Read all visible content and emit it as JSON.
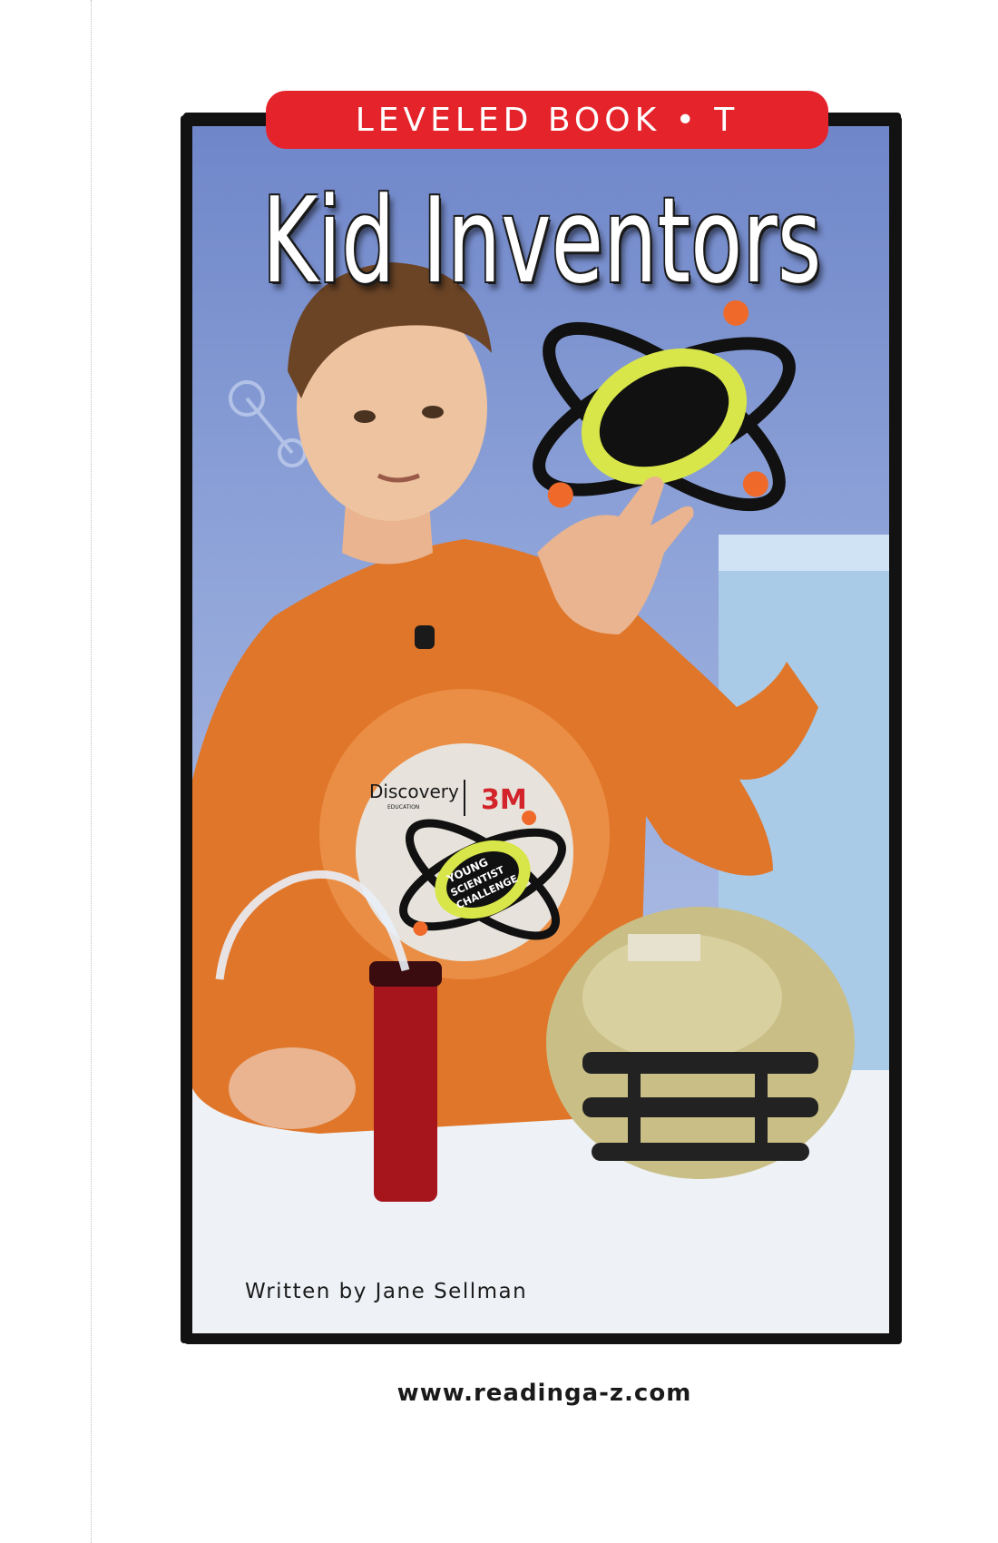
{
  "banner": {
    "label": "LEVELED BOOK • T"
  },
  "cover": {
    "title": "Kid Inventors",
    "author_line": "Written by Jane Sellman",
    "photo": {
      "sponsor_left": "Discovery",
      "sponsor_left_sub": "EDUCATION",
      "sponsor_right": "3M",
      "logo_lines": [
        "YOUNG",
        "SCIENTIST",
        "CHALLENGE"
      ]
    }
  },
  "footer": {
    "url": "www.readinga-z.com"
  },
  "colors": {
    "banner": "#e5232b",
    "shirt": "#e0762a",
    "frame": "#121212"
  }
}
